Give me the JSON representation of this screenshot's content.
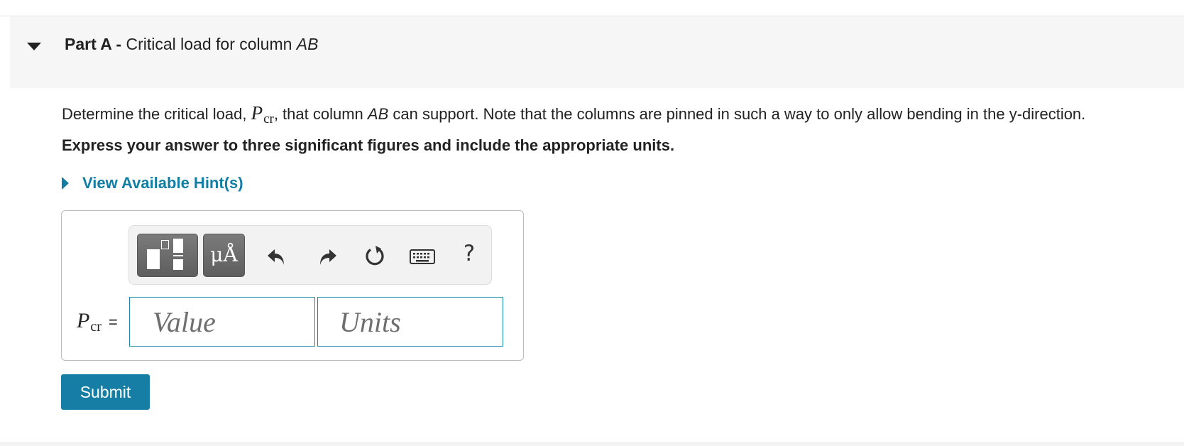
{
  "part": {
    "prefix": "Part A -",
    "title_text": "Critical load for column ",
    "title_italic": "AB"
  },
  "question": {
    "text_before": "Determine the critical load, ",
    "symbol": "P",
    "subscript": "cr",
    "text_middle": ", that column ",
    "column_italic": "AB",
    "text_after": " can support. Note that the columns are pinned in such a way to only allow bending in the y-direction."
  },
  "instructions": "Express your answer to three significant figures and include the appropriate units.",
  "hint": {
    "label": "View Available Hint(s)"
  },
  "toolbar": {
    "templates_icon": "templates-icon",
    "units_label": "μÅ",
    "undo_icon": "undo-icon",
    "redo_icon": "redo-icon",
    "reset_icon": "reset-icon",
    "keyboard_icon": "keyboard-icon",
    "help_label": "?"
  },
  "answer": {
    "symbol": "P",
    "subscript": "cr",
    "equals": "=",
    "value_placeholder": "Value",
    "units_placeholder": "Units"
  },
  "submit_label": "Submit",
  "colors": {
    "accent": "#167ea4",
    "link": "#137ea3",
    "header_bg": "#f6f6f6",
    "field_border": "#1a8aa8"
  }
}
